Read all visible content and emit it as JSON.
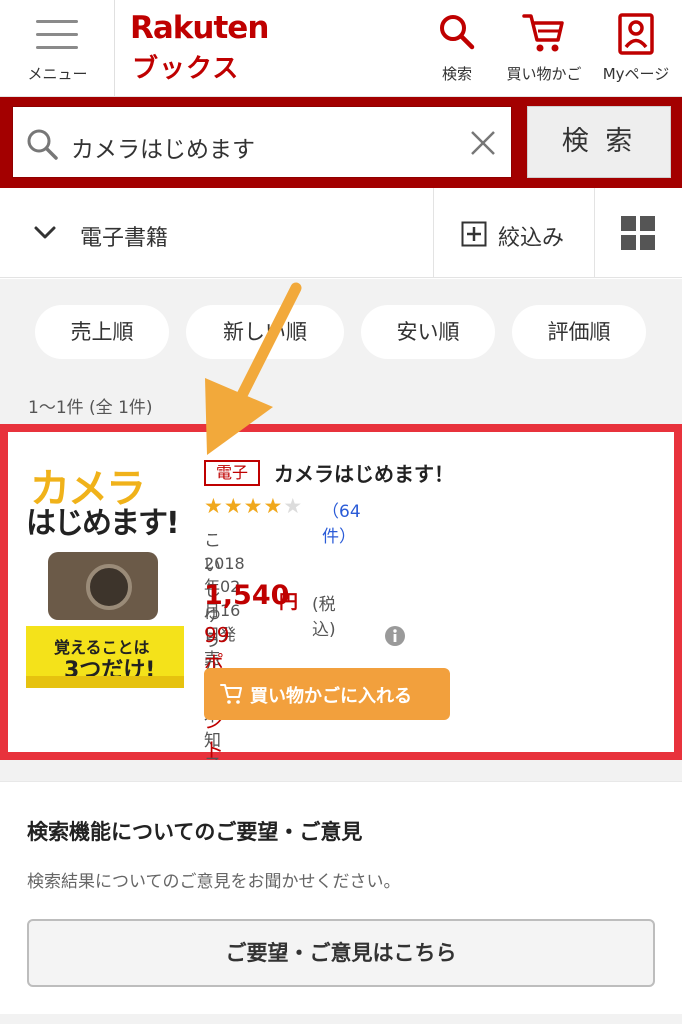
{
  "header": {
    "menu_label": "メニュー",
    "logo_line1": "Rakuten",
    "logo_line2": "ブックス",
    "search_label": "検索",
    "cart_label": "買い物かご",
    "mypage_label": "Myページ"
  },
  "search": {
    "query": "カメラはじめます",
    "button_label": "検 索"
  },
  "filters": {
    "category": "電子書籍",
    "refine_label": "絞込み"
  },
  "sort": {
    "options": [
      "売上順",
      "新しい順",
      "安い順",
      "評価順"
    ]
  },
  "results": {
    "count_text": "1〜1件 (全 1件)",
    "items": [
      {
        "badge": "電子",
        "title": "カメラはじめます！",
        "rating_stars": 4,
        "rating_max": 5,
        "review_count": "（64件）",
        "author": "こいしゆうか, 鈴木知子",
        "release": "2018年02月16日発売",
        "price": "1,540",
        "price_unit": "円",
        "tax": "(税込)",
        "points": "99ポイント(7倍)",
        "cart_button": "買い物かごに入れる",
        "cover": {
          "title_line1": "カメラ",
          "title_line2": "はじめます!",
          "band_line1": "覚えることは",
          "band_line2": "3つだけ!"
        }
      }
    ]
  },
  "feedback": {
    "heading": "検索機能についてのご要望・ご意見",
    "description": "検索結果についてのご意見をお聞かせください。",
    "button_label": "ご要望・ご意見はこちら"
  },
  "colors": {
    "brand_red": "#bf0000",
    "search_bar_bg": "#a30000",
    "highlight_border": "#e8323c",
    "cart_button": "#f2a03d",
    "star": "#f0a81d",
    "arrow": "#f2a93b"
  }
}
